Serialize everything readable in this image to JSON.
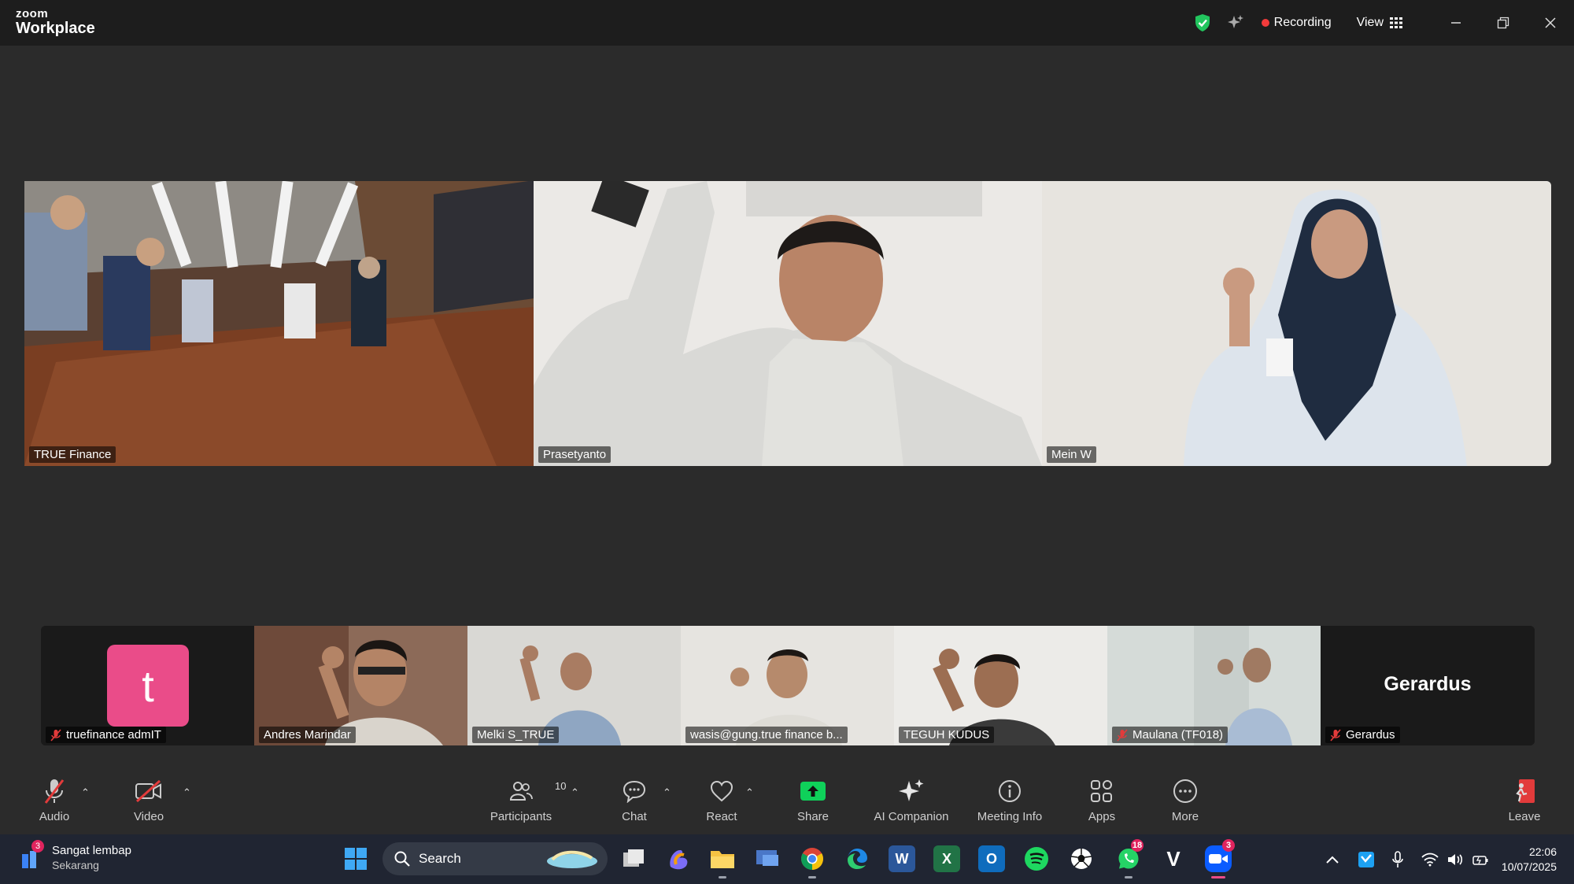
{
  "titlebar": {
    "logo_top": "zoom",
    "logo_bottom": "Workplace",
    "recording_label": "Recording",
    "view_label": "View"
  },
  "main_tiles": [
    {
      "name": "TRUE Finance"
    },
    {
      "name": "Prasetyanto"
    },
    {
      "name": "Mein W"
    }
  ],
  "strip_tiles": [
    {
      "name": "truefinance admIT",
      "avatar_letter": "t",
      "muted": true,
      "video": false
    },
    {
      "name": "Andres Marindar",
      "muted": false,
      "video": true
    },
    {
      "name": "Melki S_TRUE",
      "muted": false,
      "video": true
    },
    {
      "name": "wasis@gung.true finance b...",
      "muted": false,
      "video": true
    },
    {
      "name": "TEGUH KUDUS",
      "muted": false,
      "video": true
    },
    {
      "name": "Maulana (TF018)",
      "muted": true,
      "video": true
    },
    {
      "name": "Gerardus",
      "display_name": "Gerardus",
      "muted": true,
      "video": false
    }
  ],
  "toolbar": {
    "audio": "Audio",
    "video": "Video",
    "participants": "Participants",
    "participant_count": "10",
    "chat": "Chat",
    "react": "React",
    "share": "Share",
    "ai_companion": "AI Companion",
    "meeting_info": "Meeting Info",
    "apps": "Apps",
    "more": "More",
    "leave": "Leave"
  },
  "taskbar": {
    "weather_title": "Sangat lembap",
    "weather_sub": "Sekarang",
    "weather_badge": "3",
    "search_label": "Search",
    "whatsapp_badge": "18",
    "zoom_badge": "3",
    "time": "22:06",
    "date": "10/07/2025"
  },
  "colors": {
    "recording_dot": "#f23b3b",
    "share_green": "#0fd15a",
    "avatar_pink": "#ea4c89",
    "shield_green": "#22c55e"
  }
}
